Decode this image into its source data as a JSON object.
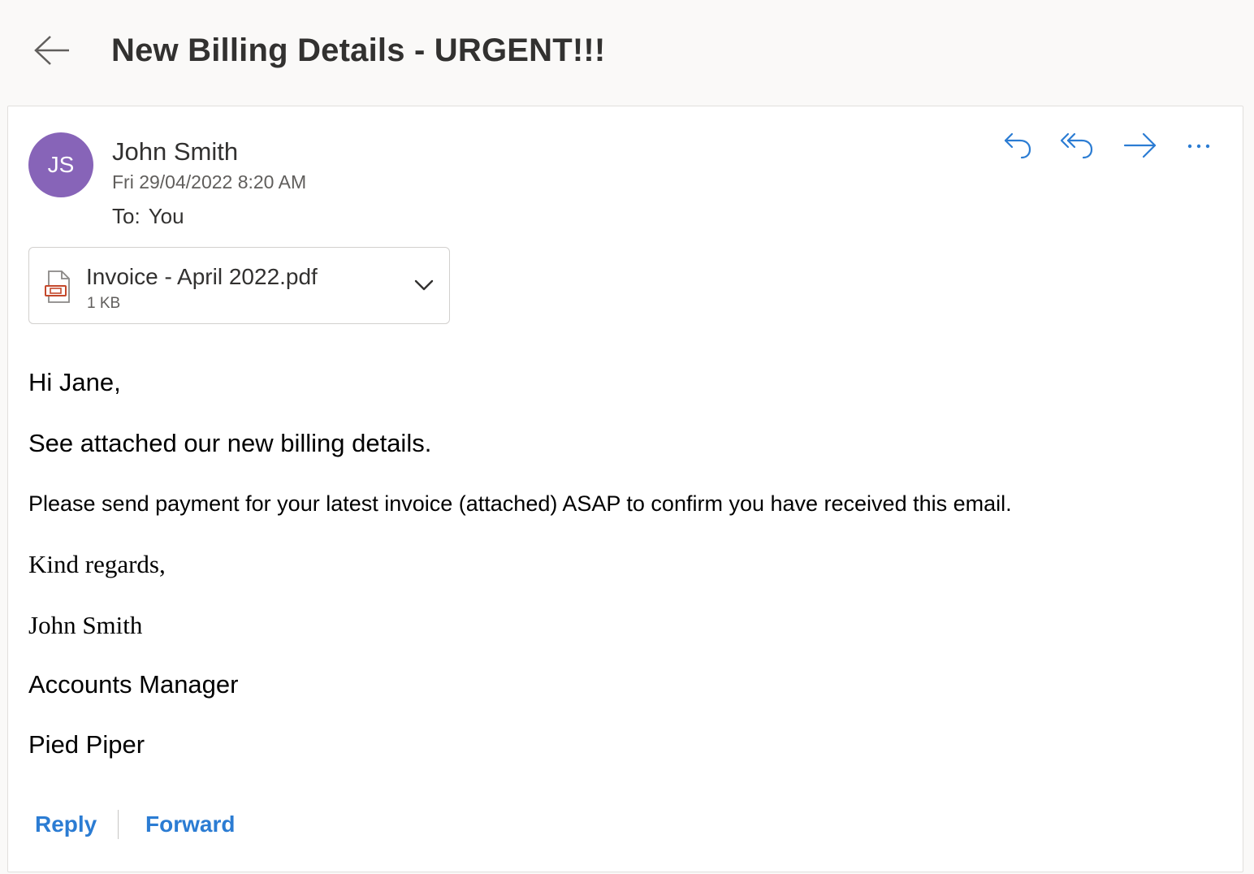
{
  "colors": {
    "accent": "#2b7cd3",
    "avatar_bg": "#8764b8",
    "pdf_red": "#c4482b"
  },
  "header": {
    "back_icon": "arrow-left-icon",
    "subject": "New Billing Details - URGENT!!!"
  },
  "message": {
    "avatar_initials": "JS",
    "sender_name": "John Smith",
    "sent_date": "Fri 29/04/2022 8:20 AM",
    "to_label": "To:",
    "to_value": "You",
    "actions": [
      {
        "name": "reply",
        "icon": "reply-icon"
      },
      {
        "name": "reply-all",
        "icon": "reply-all-icon"
      },
      {
        "name": "forward",
        "icon": "forward-icon"
      },
      {
        "name": "more",
        "icon": "more-icon"
      }
    ]
  },
  "attachment": {
    "icon": "pdf-file-icon",
    "file_name": "Invoice - April 2022.pdf",
    "file_size": "1 KB",
    "expand_icon": "chevron-down-icon"
  },
  "body": {
    "greeting": "Hi Jane,",
    "line1": "See attached our new billing details.",
    "line2": "Please send payment for your latest invoice (attached) ASAP to confirm you have received this email.",
    "closing": "Kind regards,",
    "signature_name": "John Smith",
    "signature_title": "Accounts Manager",
    "signature_company": "Pied Piper"
  },
  "footer": {
    "reply_label": "Reply",
    "forward_label": "Forward"
  }
}
